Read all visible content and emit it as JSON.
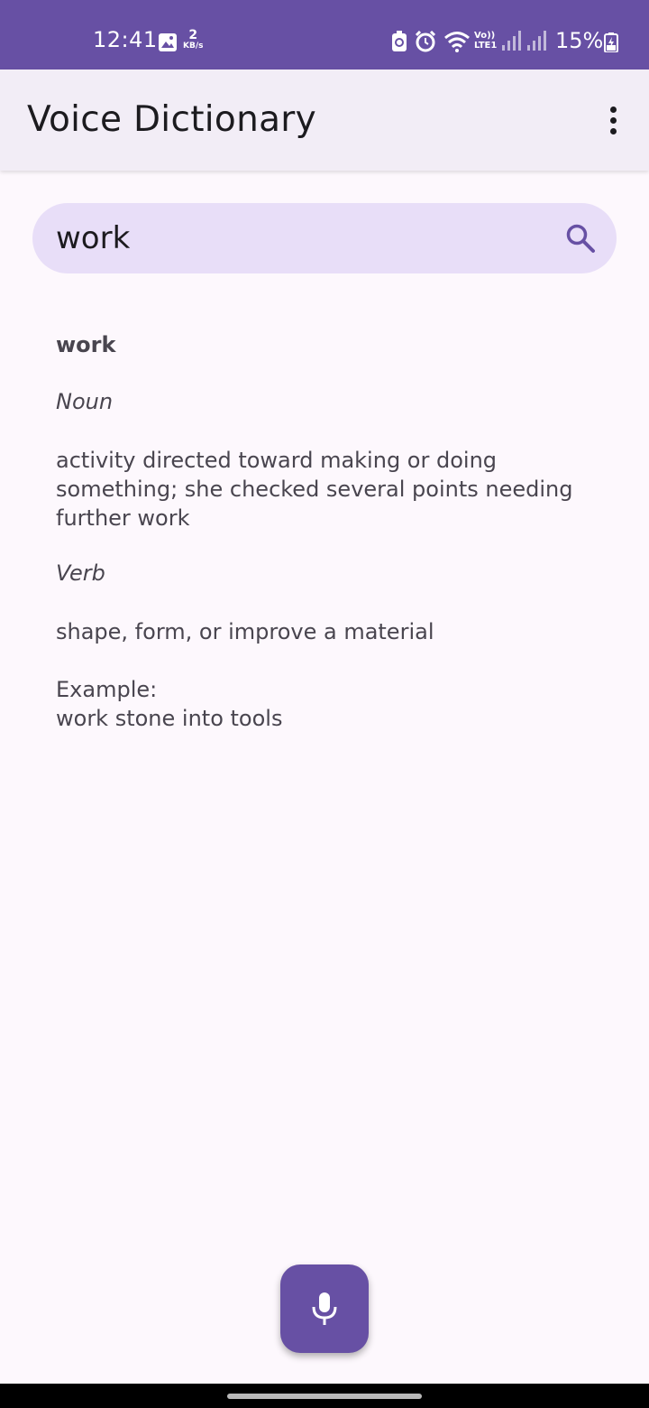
{
  "status_bar": {
    "time": "12:41",
    "network_speed_value": "2",
    "network_speed_unit": "KB/s",
    "volte_label": "Vo)) LTE1",
    "battery_percent": "15%",
    "icons": [
      "image-icon",
      "recycle-icon",
      "alarm-icon",
      "wifi-icon",
      "signal-icon",
      "signal-icon",
      "battery-charging-icon"
    ],
    "color": "#6750a4"
  },
  "app_bar": {
    "title": "Voice Dictionary",
    "overflow_icon": "more-vert-icon"
  },
  "search": {
    "value": "work",
    "placeholder": "",
    "icon": "search-icon",
    "background": "#e8def8"
  },
  "definition": {
    "word": "work",
    "entries": [
      {
        "part_of_speech": "Noun",
        "text": "activity directed toward making or doing something; she checked several points needing further work"
      },
      {
        "part_of_speech": "Verb",
        "text": "shape, form, or improve a material",
        "example_label": "Example:",
        "example": "work stone into tools"
      }
    ]
  },
  "fab": {
    "icon": "mic-icon",
    "color": "#6750a4"
  }
}
